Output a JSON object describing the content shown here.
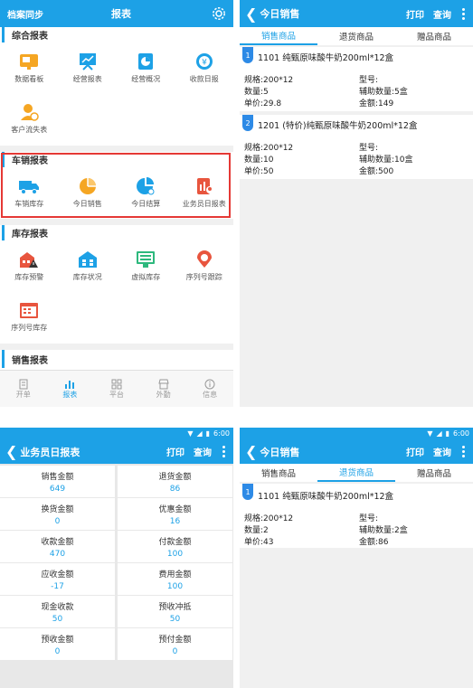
{
  "panel1": {
    "header": {
      "left": "档案同步",
      "title": "报表"
    },
    "sec_summary": {
      "title": "综合报表",
      "items": [
        "数据看板",
        "经营报表",
        "经营概况",
        "收款日报",
        "客户流失表"
      ]
    },
    "sec_van": {
      "title": "车销报表",
      "items": [
        "车销库存",
        "今日销售",
        "今日结算",
        "业务员日报表"
      ]
    },
    "sec_stock": {
      "title": "库存报表",
      "items": [
        "库存预警",
        "库存状况",
        "虚拟库存",
        "序列号跟踪",
        "序列号库存"
      ]
    },
    "sec_sales": {
      "title": "销售报表"
    },
    "nav": [
      "开单",
      "报表",
      "平台",
      "外勤",
      "信息"
    ]
  },
  "panel2": {
    "header": {
      "title": "今日销售",
      "print": "打印",
      "query": "查询"
    },
    "tabs": [
      "销售商品",
      "退货商品",
      "赠品商品"
    ],
    "items": [
      {
        "no": "1",
        "name": "1101 纯甄原味酸牛奶200ml*12盒",
        "spec": "规格:200*12",
        "model": "型号:",
        "qty": "数量:5",
        "aux": "辅助数量:5盒",
        "price": "单价:29.8",
        "amount": "金额:149"
      },
      {
        "no": "2",
        "name": "1201 (特价)纯甄原味酸牛奶200ml*12盒",
        "spec": "规格:200*12",
        "model": "型号:",
        "qty": "数量:10",
        "aux": "辅助数量:10盒",
        "price": "单价:50",
        "amount": "金额:500"
      }
    ]
  },
  "panel3": {
    "status_time": "6:00",
    "header": {
      "title": "业务员日报表",
      "print": "打印",
      "query": "查询"
    },
    "cells": [
      {
        "label": "销售金额",
        "value": "649"
      },
      {
        "label": "退货金额",
        "value": "86"
      },
      {
        "label": "换货金额",
        "value": "0"
      },
      {
        "label": "优惠金额",
        "value": "16"
      },
      {
        "label": "收款金额",
        "value": "470"
      },
      {
        "label": "付款金额",
        "value": "100"
      },
      {
        "label": "应收金额",
        "value": "-17"
      },
      {
        "label": "费用金额",
        "value": "100"
      },
      {
        "label": "现金收款",
        "value": "50"
      },
      {
        "label": "预收冲抵",
        "value": "50"
      },
      {
        "label": "预收金额",
        "value": "0"
      },
      {
        "label": "预付金额",
        "value": "0"
      }
    ]
  },
  "panel4": {
    "status_time": "6:00",
    "header": {
      "title": "今日销售",
      "print": "打印",
      "query": "查询"
    },
    "tabs": [
      "销售商品",
      "退货商品",
      "赠品商品"
    ],
    "items": [
      {
        "no": "1",
        "name": "1101 纯甄原味酸牛奶200ml*12盒",
        "spec": "规格:200*12",
        "model": "型号:",
        "qty": "数量:2",
        "aux": "辅助数量:2盒",
        "price": "单价:43",
        "amount": "金额:86"
      }
    ]
  },
  "colors": {
    "primary": "#1da1e6",
    "highlight_border": "#e53935"
  }
}
